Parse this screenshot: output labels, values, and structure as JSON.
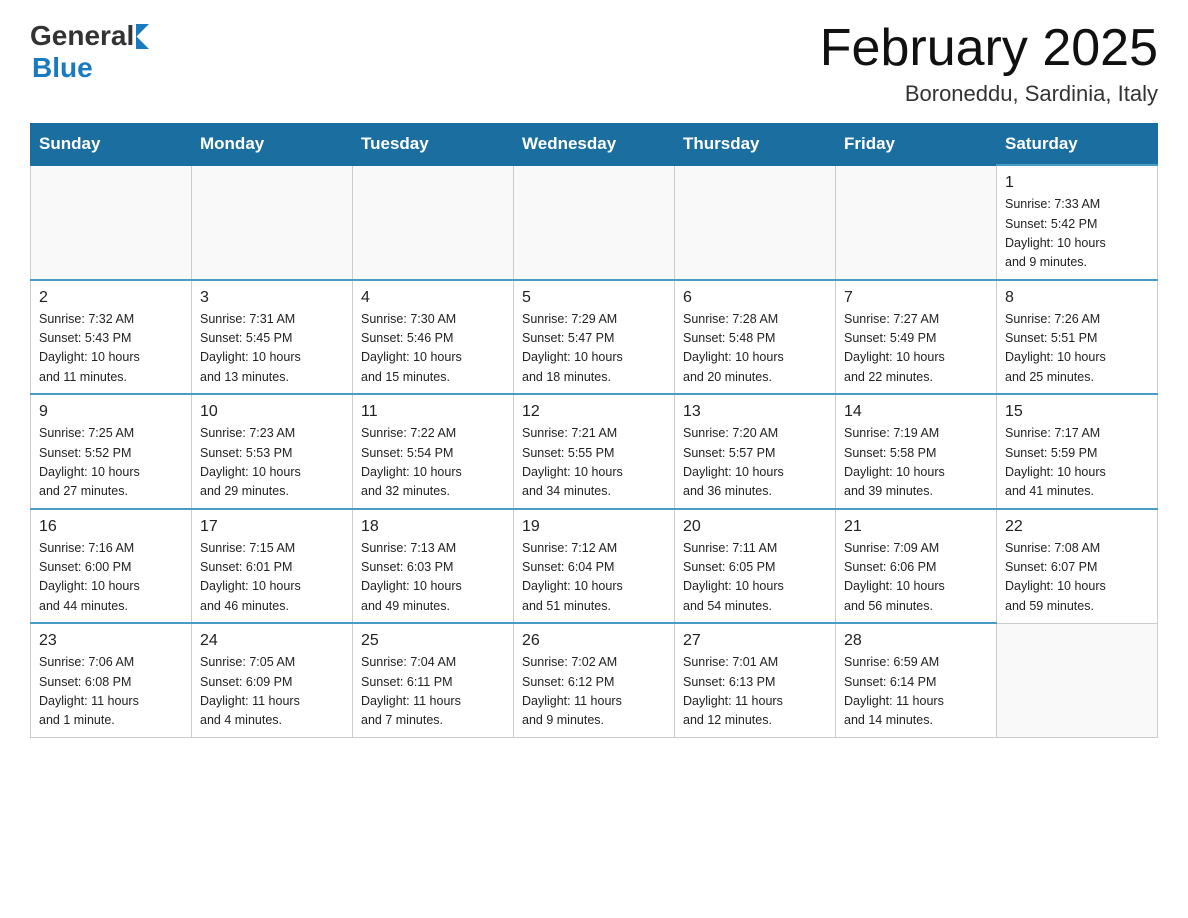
{
  "header": {
    "logo_general": "General",
    "logo_blue": "Blue",
    "month_title": "February 2025",
    "location": "Boroneddu, Sardinia, Italy"
  },
  "days_of_week": [
    "Sunday",
    "Monday",
    "Tuesday",
    "Wednesday",
    "Thursday",
    "Friday",
    "Saturday"
  ],
  "weeks": [
    [
      {
        "day": "",
        "info": ""
      },
      {
        "day": "",
        "info": ""
      },
      {
        "day": "",
        "info": ""
      },
      {
        "day": "",
        "info": ""
      },
      {
        "day": "",
        "info": ""
      },
      {
        "day": "",
        "info": ""
      },
      {
        "day": "1",
        "info": "Sunrise: 7:33 AM\nSunset: 5:42 PM\nDaylight: 10 hours\nand 9 minutes."
      }
    ],
    [
      {
        "day": "2",
        "info": "Sunrise: 7:32 AM\nSunset: 5:43 PM\nDaylight: 10 hours\nand 11 minutes."
      },
      {
        "day": "3",
        "info": "Sunrise: 7:31 AM\nSunset: 5:45 PM\nDaylight: 10 hours\nand 13 minutes."
      },
      {
        "day": "4",
        "info": "Sunrise: 7:30 AM\nSunset: 5:46 PM\nDaylight: 10 hours\nand 15 minutes."
      },
      {
        "day": "5",
        "info": "Sunrise: 7:29 AM\nSunset: 5:47 PM\nDaylight: 10 hours\nand 18 minutes."
      },
      {
        "day": "6",
        "info": "Sunrise: 7:28 AM\nSunset: 5:48 PM\nDaylight: 10 hours\nand 20 minutes."
      },
      {
        "day": "7",
        "info": "Sunrise: 7:27 AM\nSunset: 5:49 PM\nDaylight: 10 hours\nand 22 minutes."
      },
      {
        "day": "8",
        "info": "Sunrise: 7:26 AM\nSunset: 5:51 PM\nDaylight: 10 hours\nand 25 minutes."
      }
    ],
    [
      {
        "day": "9",
        "info": "Sunrise: 7:25 AM\nSunset: 5:52 PM\nDaylight: 10 hours\nand 27 minutes."
      },
      {
        "day": "10",
        "info": "Sunrise: 7:23 AM\nSunset: 5:53 PM\nDaylight: 10 hours\nand 29 minutes."
      },
      {
        "day": "11",
        "info": "Sunrise: 7:22 AM\nSunset: 5:54 PM\nDaylight: 10 hours\nand 32 minutes."
      },
      {
        "day": "12",
        "info": "Sunrise: 7:21 AM\nSunset: 5:55 PM\nDaylight: 10 hours\nand 34 minutes."
      },
      {
        "day": "13",
        "info": "Sunrise: 7:20 AM\nSunset: 5:57 PM\nDaylight: 10 hours\nand 36 minutes."
      },
      {
        "day": "14",
        "info": "Sunrise: 7:19 AM\nSunset: 5:58 PM\nDaylight: 10 hours\nand 39 minutes."
      },
      {
        "day": "15",
        "info": "Sunrise: 7:17 AM\nSunset: 5:59 PM\nDaylight: 10 hours\nand 41 minutes."
      }
    ],
    [
      {
        "day": "16",
        "info": "Sunrise: 7:16 AM\nSunset: 6:00 PM\nDaylight: 10 hours\nand 44 minutes."
      },
      {
        "day": "17",
        "info": "Sunrise: 7:15 AM\nSunset: 6:01 PM\nDaylight: 10 hours\nand 46 minutes."
      },
      {
        "day": "18",
        "info": "Sunrise: 7:13 AM\nSunset: 6:03 PM\nDaylight: 10 hours\nand 49 minutes."
      },
      {
        "day": "19",
        "info": "Sunrise: 7:12 AM\nSunset: 6:04 PM\nDaylight: 10 hours\nand 51 minutes."
      },
      {
        "day": "20",
        "info": "Sunrise: 7:11 AM\nSunset: 6:05 PM\nDaylight: 10 hours\nand 54 minutes."
      },
      {
        "day": "21",
        "info": "Sunrise: 7:09 AM\nSunset: 6:06 PM\nDaylight: 10 hours\nand 56 minutes."
      },
      {
        "day": "22",
        "info": "Sunrise: 7:08 AM\nSunset: 6:07 PM\nDaylight: 10 hours\nand 59 minutes."
      }
    ],
    [
      {
        "day": "23",
        "info": "Sunrise: 7:06 AM\nSunset: 6:08 PM\nDaylight: 11 hours\nand 1 minute."
      },
      {
        "day": "24",
        "info": "Sunrise: 7:05 AM\nSunset: 6:09 PM\nDaylight: 11 hours\nand 4 minutes."
      },
      {
        "day": "25",
        "info": "Sunrise: 7:04 AM\nSunset: 6:11 PM\nDaylight: 11 hours\nand 7 minutes."
      },
      {
        "day": "26",
        "info": "Sunrise: 7:02 AM\nSunset: 6:12 PM\nDaylight: 11 hours\nand 9 minutes."
      },
      {
        "day": "27",
        "info": "Sunrise: 7:01 AM\nSunset: 6:13 PM\nDaylight: 11 hours\nand 12 minutes."
      },
      {
        "day": "28",
        "info": "Sunrise: 6:59 AM\nSunset: 6:14 PM\nDaylight: 11 hours\nand 14 minutes."
      },
      {
        "day": "",
        "info": ""
      }
    ]
  ]
}
